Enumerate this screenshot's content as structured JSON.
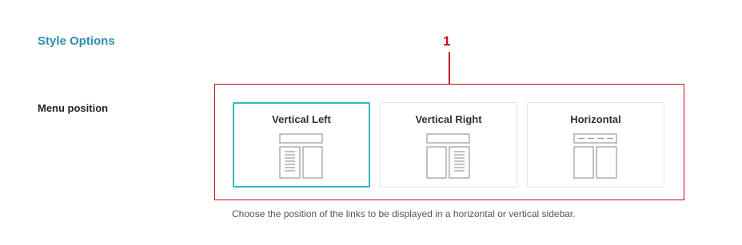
{
  "section": {
    "title": "Style Options"
  },
  "callout": {
    "number": "1"
  },
  "menu_position": {
    "label": "Menu position",
    "selected": "Vertical Left",
    "options": [
      {
        "label": "Vertical Left",
        "icon": "layout-vertical-left-icon"
      },
      {
        "label": "Vertical Right",
        "icon": "layout-vertical-right-icon"
      },
      {
        "label": "Horizontal",
        "icon": "layout-horizontal-icon"
      }
    ],
    "help_text": "Choose the position of the links to be displayed in a horizontal or vertical sidebar."
  },
  "colors": {
    "section_title": "#2e8fb0",
    "callout": "#c40e1b",
    "selected_border": "#35b7c0",
    "icon_stroke": "#9a9a9a"
  }
}
